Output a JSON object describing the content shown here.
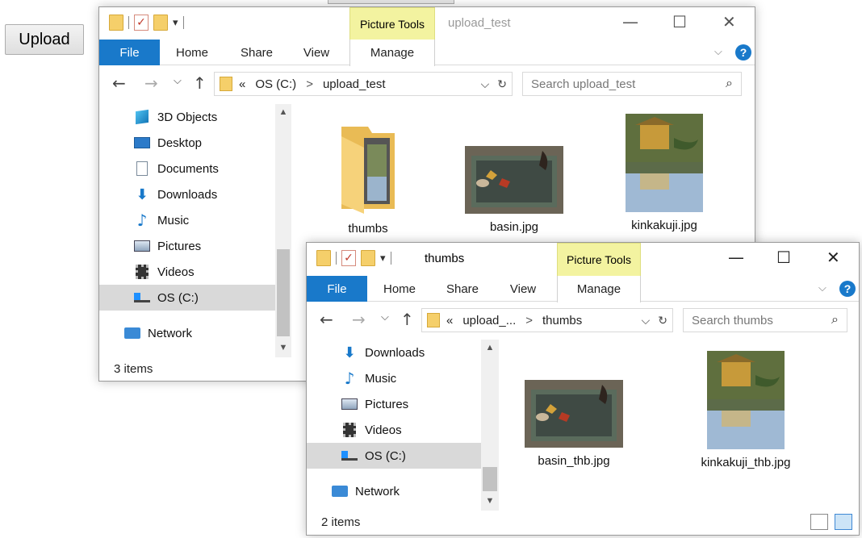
{
  "upload_button": {
    "label": "Upload"
  },
  "window1": {
    "title": "upload_test",
    "context_tools_label": "Picture Tools",
    "tabs": [
      "File",
      "Home",
      "Share",
      "View",
      "Manage"
    ],
    "address": {
      "prefix": "«",
      "crumbs": [
        "OS (C:)",
        "upload_test"
      ],
      "separator": ">"
    },
    "search_placeholder": "Search upload_test",
    "nav_items": [
      {
        "label": "3D Objects",
        "icon": "3d-objects-icon"
      },
      {
        "label": "Desktop",
        "icon": "desktop-icon"
      },
      {
        "label": "Documents",
        "icon": "documents-icon"
      },
      {
        "label": "Downloads",
        "icon": "downloads-icon"
      },
      {
        "label": "Music",
        "icon": "music-icon"
      },
      {
        "label": "Pictures",
        "icon": "pictures-icon"
      },
      {
        "label": "Videos",
        "icon": "videos-icon"
      },
      {
        "label": "OS (C:)",
        "icon": "drive-icon",
        "selected": true
      },
      {
        "label": "Network",
        "icon": "network-icon"
      }
    ],
    "items": [
      {
        "name": "thumbs",
        "kind": "folder"
      },
      {
        "name": "basin.jpg",
        "kind": "image"
      },
      {
        "name": "kinkakuji.jpg",
        "kind": "image"
      }
    ],
    "status": "3 items"
  },
  "window2": {
    "title": "thumbs",
    "context_tools_label": "Picture Tools",
    "tabs": [
      "File",
      "Home",
      "Share",
      "View",
      "Manage"
    ],
    "address": {
      "prefix": "«",
      "crumbs": [
        "upload_...",
        "thumbs"
      ],
      "separator": ">"
    },
    "search_placeholder": "Search thumbs",
    "nav_items": [
      {
        "label": "Downloads",
        "icon": "downloads-icon"
      },
      {
        "label": "Music",
        "icon": "music-icon"
      },
      {
        "label": "Pictures",
        "icon": "pictures-icon"
      },
      {
        "label": "Videos",
        "icon": "videos-icon"
      },
      {
        "label": "OS (C:)",
        "icon": "drive-icon",
        "selected": true
      },
      {
        "label": "Network",
        "icon": "network-icon"
      }
    ],
    "items": [
      {
        "name": "basin_thb.jpg",
        "kind": "image"
      },
      {
        "name": "kinkakuji_thb.jpg",
        "kind": "image"
      }
    ],
    "status": "2 items"
  },
  "colors": {
    "file_tab": "#1979ca",
    "context_tools": "#f3f3a0",
    "selection": "#d9d9d9"
  }
}
